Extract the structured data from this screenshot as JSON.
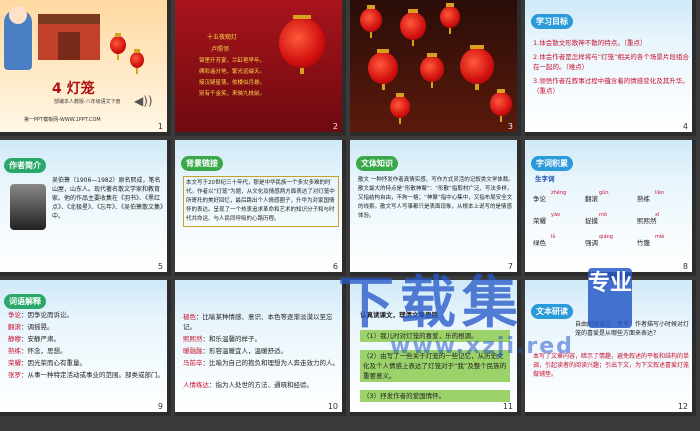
{
  "slides": [
    {
      "num": "1",
      "title": "4 灯笼",
      "publisher": "部编本人教版·八年级语文下册",
      "site": "第一PPT模板网-WWW.1PPT.COM"
    },
    {
      "num": "2",
      "poem_title": "十五夜观灯",
      "poem_author": "卢照邻",
      "poem_lines": [
        "锦里开芳宴，兰缸艳早年。",
        "缛彩遥分地，繁光远缀天。",
        "接汉疑星落，依楼似月悬。",
        "别有千金笑，来映九枝前。"
      ]
    },
    {
      "num": "3"
    },
    {
      "num": "4",
      "tag": "学习目标",
      "goals": [
        "1.体会散文形散神不散的特点。（重点）",
        "2.体会作者是怎样将与“灯笼”相关的各个场景片段组合在一起的。（难点）",
        "3.领悟作者在叙事过程中蕴含着的情感变化及其升华。（重点）"
      ]
    },
    {
      "num": "5",
      "tag": "作者简介",
      "bio": "吴伯箫（1906—1982）原名熙成，笔名山屋，山东人。现代著名散文学家和教育家。他的作品主要收集在《羽书》、《黑红点》、《北极星》、《忘年》、《吴伯箫散文集》中。"
    },
    {
      "num": "6",
      "tag": "背景链接",
      "bg": "本文写于20世纪三十年代，那是中华民族一个多灾多难的时代。作者以“灯笼”为题，从文化及情感两方面表达了对灯笼中所寄托的美好回忆，最后跳出个人情感圈子，升华为对家国情怀的表达。呈现了一个热衷追求革命和艺术的知识分子和与时代共命运、与人民同呼吸的心路历程。"
    },
    {
      "num": "7",
      "tag": "文体知识",
      "genre": "散文 一种抒发作者真情实感、写作方式灵活的记叙类文学体裁。散文最大的特点是“形散神聚”：“形散”指取材广泛、写法多样，又指结构自由，不拘一格；“神聚”指中心集中，又指布局安全文的线索。散文写人写事都只是表面现象，从根本上说写的是情感体验。"
    },
    {
      "num": "8",
      "tag": "字词积累",
      "sub": "生字词",
      "words": [
        [
          "争论",
          "zhēng"
        ],
        [
          "翻滚",
          "gǔn"
        ],
        [
          "熟练",
          "liàn"
        ],
        [
          "荣耀",
          "yào"
        ],
        [
          "捉摸",
          "mō"
        ],
        [
          "熙熙然",
          "xī"
        ],
        [
          "绿色",
          "lǜ"
        ],
        [
          "强调",
          "qiáng"
        ],
        [
          "竹篾",
          "miè"
        ]
      ]
    },
    {
      "num": "9",
      "tag": "词语解释",
      "defs": [
        [
          "争论",
          "因争论而诉讼。"
        ],
        [
          "翻滚",
          "调摇晃。"
        ],
        [
          "静穆",
          "安静严肃。"
        ],
        [
          "熟练",
          "怀念，思想。"
        ],
        [
          "荣耀",
          "因光荣而心有重量。"
        ],
        [
          "张罗",
          "从事一种特定活动或事业的范围。部类或部门。"
        ]
      ]
    },
    {
      "num": "10",
      "defs": [
        [
          "褪色",
          "比喻某种情感、意识、本色等逐渐淡漠以至忘记。"
        ],
        [
          "熙熙然",
          "和乐温馨的样子。"
        ],
        [
          "暖融融",
          "形容温暖宜人，温暖舒适。"
        ],
        [
          "马前卒",
          "比喻为自己的抱负和理想为人奔走效力的人。"
        ],
        [
          "人情练达",
          "指为人处世的方法、通晓和经验。"
        ]
      ]
    },
    {
      "num": "11",
      "head": "认真读课文，理清文章思路",
      "points": [
        "（1）我儿时对灯笼的喜爱，乐的根源。",
        "（2）由写了一些关于灯笼的一些记忆，从历史文化及个人情感上表达了灯笼对于“我”及整个民族的重要意义。",
        "（3）抒发作者的爱国情怀。"
      ]
    },
    {
      "num": "12",
      "tag": "文本研读",
      "intro": "自由朗读课文，思考：作者描写小时候对灯笼的喜爱是从哪些方面来表达？",
      "answer": "本写了文章内容，暗示了情趣，避免叙述的平板和结构的单调，引起读者的阅读兴趣；引出下文，为下文叙述喜爱灯笼做铺垫。"
    }
  ],
  "watermark": {
    "main": "下载集",
    "badge": "专业",
    "url": "www.xzji.red"
  }
}
